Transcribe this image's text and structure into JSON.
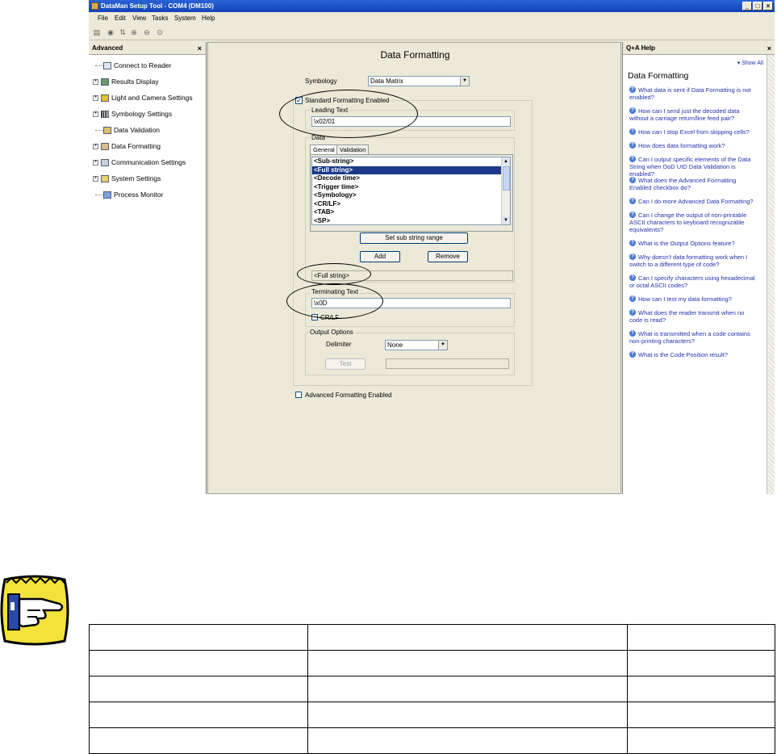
{
  "window": {
    "title": "DataMan Setup Tool - COM4 (DM100)",
    "controls": [
      "_",
      "□",
      "×"
    ]
  },
  "menu": [
    "File",
    "Edit",
    "View",
    "Tasks",
    "System",
    "Help"
  ],
  "toolbar_icons": [
    "save-icon",
    "open-icon",
    "connect-icon",
    "zoom-in-icon",
    "zoom-out-icon",
    "zoom-fit-icon"
  ],
  "left_panel": {
    "title": "Advanced",
    "close": "×",
    "items": [
      {
        "label": "Connect to Reader",
        "expandable": false
      },
      {
        "label": "Results Display",
        "expandable": true
      },
      {
        "label": "Light and Camera Settings",
        "expandable": true
      },
      {
        "label": "Symbology Settings",
        "expandable": true
      },
      {
        "label": "Data Validation",
        "expandable": false
      },
      {
        "label": "Data Formatting",
        "expandable": true
      },
      {
        "label": "Communication Settings",
        "expandable": true
      },
      {
        "label": "System Settings",
        "expandable": true
      },
      {
        "label": "Process Monitor",
        "expandable": false
      }
    ]
  },
  "main": {
    "title": "Data Formatting",
    "symbology_label": "Symbology",
    "symbology_value": "Data Matrix",
    "standard_enabled_label": "Standard Formatting Enabled",
    "leading_text_label": "Leading Text",
    "leading_text_value": "\\x02/01",
    "data_label": "Data",
    "tabs": [
      "General",
      "Validation"
    ],
    "data_list": [
      "<Sub-string>",
      "<Full string>",
      "<Decode time>",
      "<Trigger time>",
      "<Symbology>",
      "<CR/LF>",
      "<TAB>",
      "<SP>"
    ],
    "selected_index": 1,
    "set_substring_button": "Set sub string range",
    "add_button": "Add",
    "remove_button": "Remove",
    "data_result": "<Full string>",
    "terminating_text_label": "Terminating Text",
    "terminating_text_value": "\\x0D",
    "crlf_label": "CR/LF",
    "output_options_label": "Output Options",
    "delimiter_label": "Delimiter",
    "delimiter_value": "None",
    "test_button": "Test",
    "advanced_enabled_label": "Advanced Formatting Enabled"
  },
  "help_panel": {
    "title": "Q+A Help",
    "close": "×",
    "show_all": "▾ Show All",
    "heading": "Data Formatting",
    "links": [
      "What data is sent if Data Formatting is not enabled?",
      "How can I send just the decoded data without a carriage return/line feed pair?",
      "How can I stop Excel from skipping cells?",
      "How does data formatting work?",
      "Can I output specific elements of the Data String when DoD UID Data Validation is enabled?",
      "What does the Advanced Formatting Enabled checkbox do?",
      "Can I do more Advanced Data Formatting?",
      "Can I change the output of non-printable ASCII characters to keyboard recognizable equivalents?",
      "What is the Output Options feature?",
      "Why doesn't data formatting work when I switch to a different type of code?",
      "Can I specify characters using hexadecimal or octal ASCII codes?",
      "How can I test my data formatting?",
      "What does the reader transmit when no code is read?",
      "What is transmitted when a code contains non-printing characters?",
      "What is the Code Position result?"
    ]
  },
  "colors": {
    "title_bar": "#1a4fc8",
    "selection": "#1c3a8a",
    "help_link": "#2233aa",
    "pointer_yellow": "#f2e23a"
  }
}
